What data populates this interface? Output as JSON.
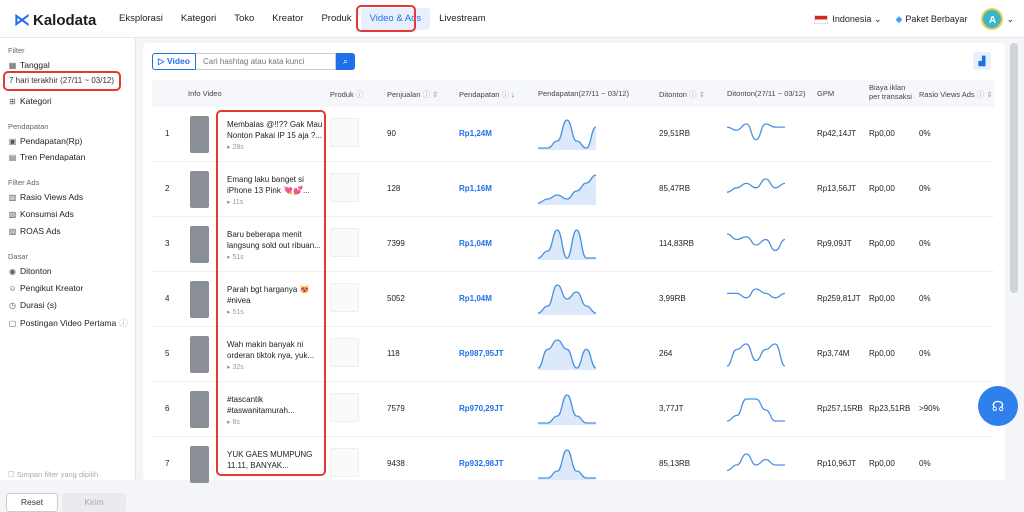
{
  "brand": {
    "name": "Kalodata"
  },
  "nav": {
    "items": [
      "Eksplorasi",
      "Kategori",
      "Toko",
      "Kreator",
      "Produk",
      "Video & Ads",
      "Livestream"
    ],
    "active": "Video & Ads"
  },
  "topright": {
    "language": "Indonesia",
    "plan": "Paket Berbayar",
    "avatar": "A"
  },
  "sidebar": {
    "filter_label": "Filter",
    "date_label": "Tanggal",
    "date_value": "7 hari terakhir (27/11 ~ 03/12)",
    "category": "Kategori",
    "sec_revenue": "Pendapatan",
    "revenue_rp": "Pendapatan(Rp)",
    "revenue_trend": "Tren Pendapatan",
    "sec_ads": "Filter Ads",
    "ads_ratio": "Rasio Views Ads",
    "ads_consumption": "Konsumsi Ads",
    "roas": "ROAS Ads",
    "sec_basic": "Dasar",
    "views": "Ditonton",
    "followers": "Pengikut Kreator",
    "duration": "Durasi (s)",
    "first_post": "Postingan Video Pertama",
    "save_filter": "Simpan filter yang dipilih",
    "reset": "Reset",
    "submit": "Kirim"
  },
  "search": {
    "video_tab": "Video",
    "placeholder": "Cari hashtag atau kata kunci"
  },
  "table": {
    "headers": {
      "info": "Info Video",
      "product": "Produk",
      "sales": "Penjualan",
      "revenue": "Pendapatan",
      "revenue_trend": "Pendapatan(27/11 ~ 03/12)",
      "views": "Ditonton",
      "views_trend": "Ditonton(27/11 ~ 03/12)",
      "gpm": "GPM",
      "ad_cost_1": "Biaya iklan",
      "ad_cost_2": "per transaksi",
      "ratio": "Rasio Views Ads"
    },
    "rows": [
      {
        "rank": "1",
        "title1": "Membalas @!!?? Gak Mau",
        "title2": "Nonton Pakai IP 15 aja ?...",
        "duration": "28s",
        "sales": "90",
        "revenue": "Rp1,24M",
        "views": "29,51RB",
        "gpm": "Rp42,14JT",
        "ad_cost": "Rp0,00",
        "ratio": "0%",
        "rev_trend": [
          0,
          0,
          1,
          4,
          1,
          0,
          3
        ],
        "view_trend": [
          6,
          5,
          7,
          2,
          7,
          6,
          6
        ]
      },
      {
        "rank": "2",
        "title1": "Emang laku banget si",
        "title2": "iPhone 13 Pink 💘💕...",
        "duration": "11s",
        "sales": "128",
        "revenue": "Rp1,16M",
        "views": "85,47RB",
        "gpm": "Rp13,56JT",
        "ad_cost": "Rp0,00",
        "ratio": "0%",
        "rev_trend": [
          0,
          1,
          2,
          1,
          3,
          5,
          7
        ],
        "view_trend": [
          2,
          3,
          4,
          3,
          5,
          3,
          4
        ]
      },
      {
        "rank": "3",
        "title1": "Baru beberapa menit",
        "title2": "langsung sold out ribuan...",
        "duration": "51s",
        "sales": "7399",
        "revenue": "Rp1,04M",
        "views": "114,83RB",
        "gpm": "Rp9,09JT",
        "ad_cost": "Rp0,00",
        "ratio": "0%",
        "rev_trend": [
          0,
          1,
          4,
          0,
          4,
          0,
          0
        ],
        "view_trend": [
          8,
          6,
          7,
          4,
          6,
          2,
          6
        ]
      },
      {
        "rank": "4",
        "title1": "Parah bgt harganya 😻",
        "title2": "#nivea",
        "duration": "51s",
        "sales": "5052",
        "revenue": "Rp1,04M",
        "views": "3,99RB",
        "gpm": "Rp259,81JT",
        "ad_cost": "Rp0,00",
        "ratio": "0%",
        "rev_trend": [
          0,
          1,
          4,
          2,
          3,
          1,
          0
        ],
        "view_trend": [
          4,
          4,
          3,
          5,
          4,
          3,
          4
        ]
      },
      {
        "rank": "5",
        "title1": "Wah makin banyak ni",
        "title2": "orderan tiktok nya, yuk...",
        "duration": "32s",
        "sales": "118",
        "revenue": "Rp987,95JT",
        "views": "264",
        "gpm": "Rp3,74M",
        "ad_cost": "Rp0,00",
        "ratio": "0%",
        "rev_trend": [
          0,
          2,
          3,
          2,
          0,
          2,
          0
        ],
        "view_trend": [
          0,
          3,
          4,
          1,
          3,
          4,
          0
        ]
      },
      {
        "rank": "6",
        "title1": "#tascantik",
        "title2": "#taswanitamurah...",
        "duration": "8s",
        "sales": "7579",
        "revenue": "Rp970,29JT",
        "views": "3,77JT",
        "gpm": "Rp257,15RB",
        "ad_cost": "Rp23,51RB",
        "ratio": ">90%",
        "rev_trend": [
          0,
          0,
          1,
          4,
          1,
          0,
          0
        ],
        "view_trend": [
          0,
          1,
          4,
          4,
          2,
          0,
          0
        ]
      },
      {
        "rank": "7",
        "title1": "YUK GAES MUMPUNG",
        "title2": "11.11, BANYAK...",
        "duration": "",
        "sales": "9438",
        "revenue": "Rp932,98JT",
        "views": "85,13RB",
        "gpm": "Rp10,96JT",
        "ad_cost": "Rp0,00",
        "ratio": "0%",
        "rev_trend": [
          0,
          0,
          1,
          4,
          1,
          0,
          0
        ],
        "view_trend": [
          1,
          2,
          4,
          2,
          3,
          2,
          2
        ]
      }
    ]
  }
}
